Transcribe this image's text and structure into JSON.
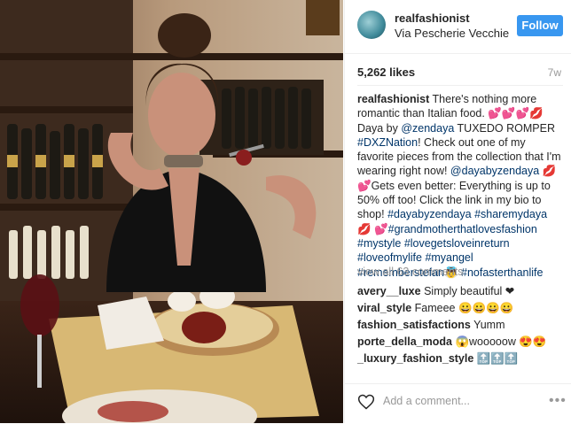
{
  "post": {
    "username": "realfashionist",
    "location": "Via Pescherie Vecchie",
    "follow_label": "Follow",
    "likes": "5,262 likes",
    "time": "7w",
    "caption_user": "realfashionist",
    "caption_parts": [
      {
        "t": "text",
        "v": " There's nothing more romantic than Italian food. "
      },
      {
        "t": "emoji",
        "v": "💕💕💕💋"
      },
      {
        "t": "text",
        "v": " Daya by "
      },
      {
        "t": "tag",
        "v": "@zendaya"
      },
      {
        "t": "text",
        "v": " TUXEDO ROMPER "
      },
      {
        "t": "tag",
        "v": "#DXZNation"
      },
      {
        "t": "text",
        "v": "! Check out one of my favorite pieces from the collection that I'm wearing right now! "
      },
      {
        "t": "tag",
        "v": "@dayabyzendaya"
      },
      {
        "t": "text",
        "v": " "
      },
      {
        "t": "emoji",
        "v": "💋💕"
      },
      {
        "t": "text",
        "v": "Gets even better: Everything is up to 50% off too! Click the link in my bio to shop! "
      },
      {
        "t": "tag",
        "v": "#dayabyzendaya"
      },
      {
        "t": "text",
        "v": " "
      },
      {
        "t": "tag",
        "v": "#sharemydaya"
      },
      {
        "t": "text",
        "v": " "
      },
      {
        "t": "emoji",
        "v": "💋"
      },
      {
        "t": "text",
        "v": " "
      },
      {
        "t": "emoji",
        "v": "💕"
      },
      {
        "t": "tag",
        "v": "#grandmotherthatlovesfashion"
      },
      {
        "t": "text",
        "v": " "
      },
      {
        "t": "tag",
        "v": "#mystyle"
      },
      {
        "t": "text",
        "v": " "
      },
      {
        "t": "tag",
        "v": "#lovegetsloveinreturn"
      },
      {
        "t": "text",
        "v": " "
      },
      {
        "t": "tag",
        "v": "#loveofmylife"
      },
      {
        "t": "text",
        "v": " "
      },
      {
        "t": "tag",
        "v": "#myangel"
      },
      {
        "t": "text",
        "v": " "
      },
      {
        "t": "tag",
        "v": "#rememberstefan"
      },
      {
        "t": "emoji",
        "v": "👼"
      },
      {
        "t": "text",
        "v": " "
      },
      {
        "t": "tag",
        "v": "#nofasterthanlife"
      }
    ],
    "view_all": "view all 63 comments",
    "comments": [
      {
        "user": "avery__luxe",
        "text": "Simply beautiful ❤"
      },
      {
        "user": "viral_style",
        "text": "Fameee 😀😀😀😀"
      },
      {
        "user": "fashion_satisfactions",
        "text": "Yumm"
      },
      {
        "user": "porte_della_moda",
        "text": "😱wooooow 😍😍"
      },
      {
        "user": "_luxury_fashion_style",
        "text": "🔝🔝🔝"
      }
    ],
    "add_comment_placeholder": "Add a comment...",
    "more_label": "•••"
  },
  "colors": {
    "follow_bg": "#3897f0",
    "hashtag": "#003569",
    "muted": "#999999"
  },
  "icons": [
    "avatar-image",
    "heart-outline-icon",
    "more-options-icon"
  ]
}
